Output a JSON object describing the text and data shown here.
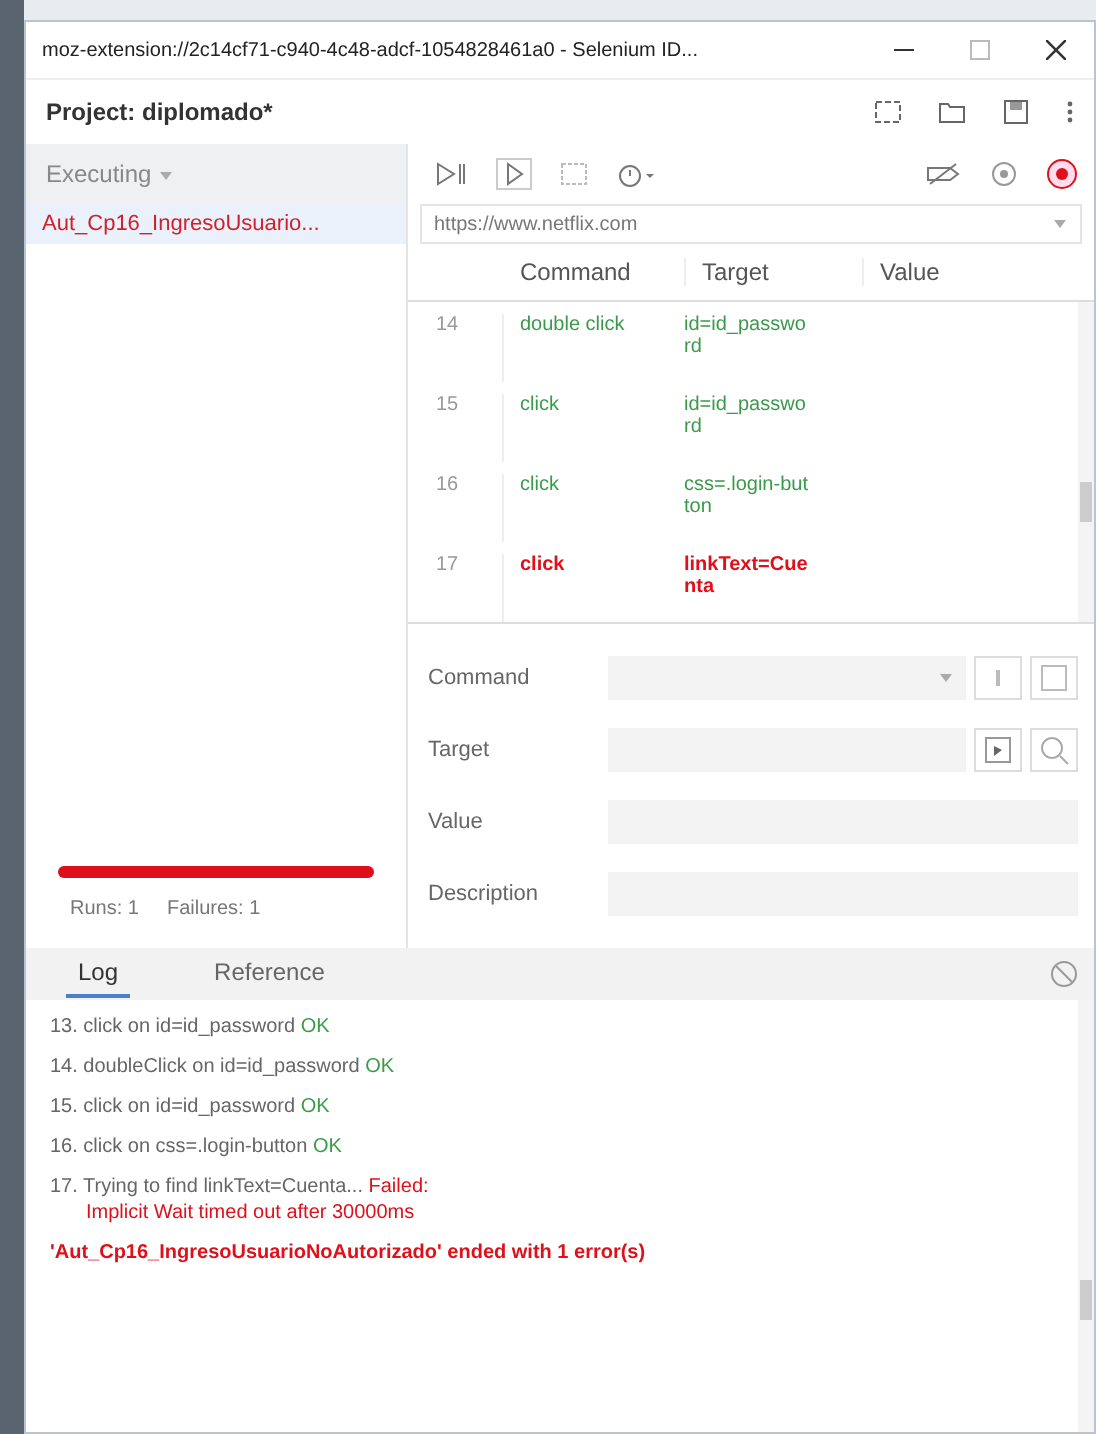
{
  "window": {
    "title": "moz-extension://2c14cf71-c940-4c48-adcf-1054828461a0 - Selenium ID..."
  },
  "project": {
    "title": "Project:  diplomado*"
  },
  "sidebar": {
    "mode": "Executing",
    "tests": [
      {
        "name": "Aut_Cp16_IngresoUsuario...",
        "selected": true,
        "failed": true
      }
    ],
    "progress": {
      "level": 1,
      "failed": true
    },
    "runs": "Runs: 1",
    "failures": "Failures: 1"
  },
  "url": "https://www.netflix.com",
  "table": {
    "columns": [
      "Command",
      "Target",
      "Value"
    ],
    "rows": [
      {
        "index": "14",
        "command": "double click",
        "target": "id=id_password",
        "failed": false
      },
      {
        "index": "15",
        "command": "click",
        "target": "id=id_password",
        "failed": false
      },
      {
        "index": "16",
        "command": "click",
        "target": "css=.login-button",
        "failed": false
      },
      {
        "index": "17",
        "command": "click",
        "target": "linkText=Cuenta",
        "failed": true
      }
    ]
  },
  "editor": {
    "fields": [
      {
        "label": "Command"
      },
      {
        "label": "Target"
      },
      {
        "label": "Value"
      },
      {
        "label": "Description"
      }
    ]
  },
  "log_tabs": [
    {
      "label": "Log",
      "selected": true
    },
    {
      "label": "Reference",
      "selected": false
    }
  ],
  "log": [
    {
      "text": "13. click on id=id_password",
      "result": "OK",
      "failed": false
    },
    {
      "text": "14. doubleClick on id=id_password",
      "result": "OK",
      "failed": false
    },
    {
      "text": "15. click on id=id_password",
      "result": "OK",
      "failed": false
    },
    {
      "text": "16. click on css=.login-button",
      "result": "OK",
      "failed": false
    },
    {
      "text": "17. Trying to find linkText=Cuenta...",
      "result": "Failed:",
      "detail": "Implicit Wait timed out after 30000ms",
      "failed": true
    }
  ],
  "log_summary": "'Aut_Cp16_IngresoUsuarioNoAutorizado' ended with 1 error(s)"
}
